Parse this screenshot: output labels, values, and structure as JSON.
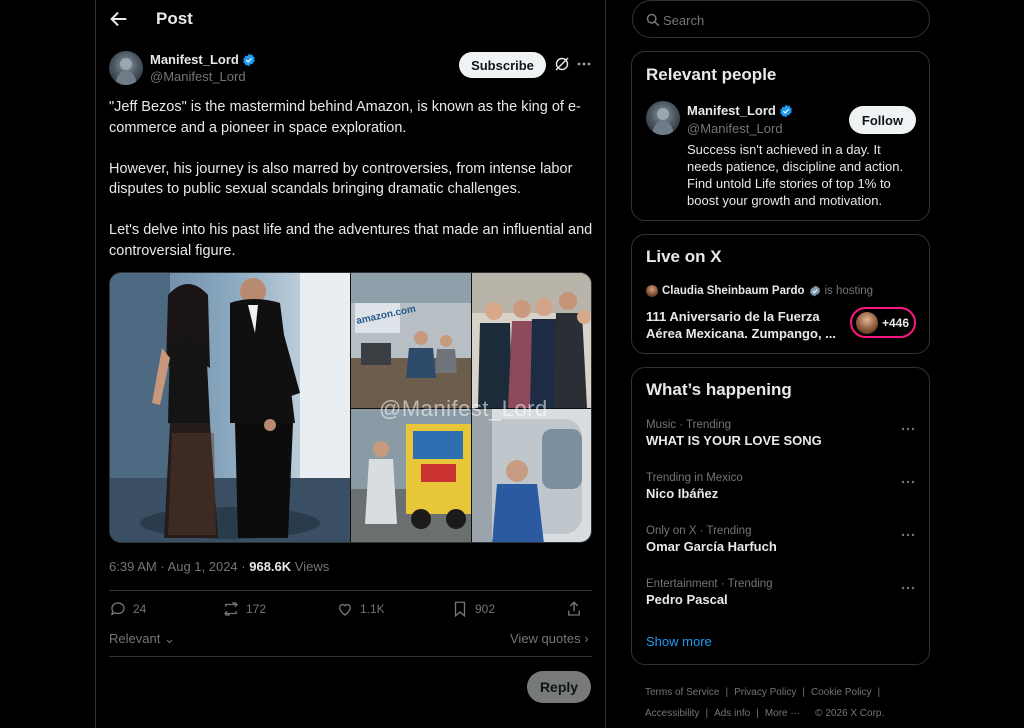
{
  "header": {
    "title": "Post"
  },
  "post": {
    "author_name": "Manifest_Lord",
    "author_handle": "@Manifest_Lord",
    "subscribe_label": "Subscribe",
    "paragraphs": [
      "\"Jeff Bezos\" is the mastermind behind Amazon, is known as the king of e-commerce and a pioneer in space exploration.",
      "However, his journey is also marred by controversies, from intense labor disputes to public sexual scandals bringing dramatic challenges.",
      "Let's delve into his past life and the adventures that made an influential and controversial figure."
    ],
    "watermark": "@Manifest_Lord",
    "time": "6:39 AM",
    "date": "Aug 1, 2024",
    "views_count": "968.6K",
    "views_label": "Views",
    "replies": "24",
    "reposts": "172",
    "likes": "1.1K",
    "bookmarks": "902",
    "sort_label": "Relevant",
    "view_quotes_label": "View quotes",
    "reply_label": "Reply"
  },
  "search": {
    "placeholder": "Search"
  },
  "relevant_people": {
    "title": "Relevant people",
    "name": "Manifest_Lord",
    "handle": "@Manifest_Lord",
    "follow_label": "Follow",
    "bio": "Success isn't achieved in a day. It needs patience, discipline and action. Find untold Life stories of top 1% to boost your growth and motivation."
  },
  "live": {
    "title": "Live on X",
    "host": "Claudia Sheinbaum Pardo",
    "hosting": "is hosting",
    "event": "111 Aniversario de la Fuerza Aérea Mexicana. Zumpango, ...",
    "listeners": "+446"
  },
  "trends": {
    "title": "What’s happening",
    "items": [
      {
        "meta": "Music · Trending",
        "name": "WHAT IS YOUR LOVE SONG"
      },
      {
        "meta": "Trending in Mexico",
        "name": "Nico Ibáñez"
      },
      {
        "meta": "Only on X · Trending",
        "name": "Omar García Harfuch"
      },
      {
        "meta": "Entertainment · Trending",
        "name": "Pedro Pascal"
      }
    ],
    "show_more": "Show more"
  },
  "footer": {
    "terms": "Terms of Service",
    "privacy": "Privacy Policy",
    "cookie": "Cookie Policy",
    "accessibility": "Accessibility",
    "ads": "Ads info",
    "more": "More ···",
    "copyright": "© 2026 X Corp."
  },
  "colors": {
    "accent": "#1d9bf0",
    "live_ring": "#f91880",
    "background": "#000000"
  }
}
